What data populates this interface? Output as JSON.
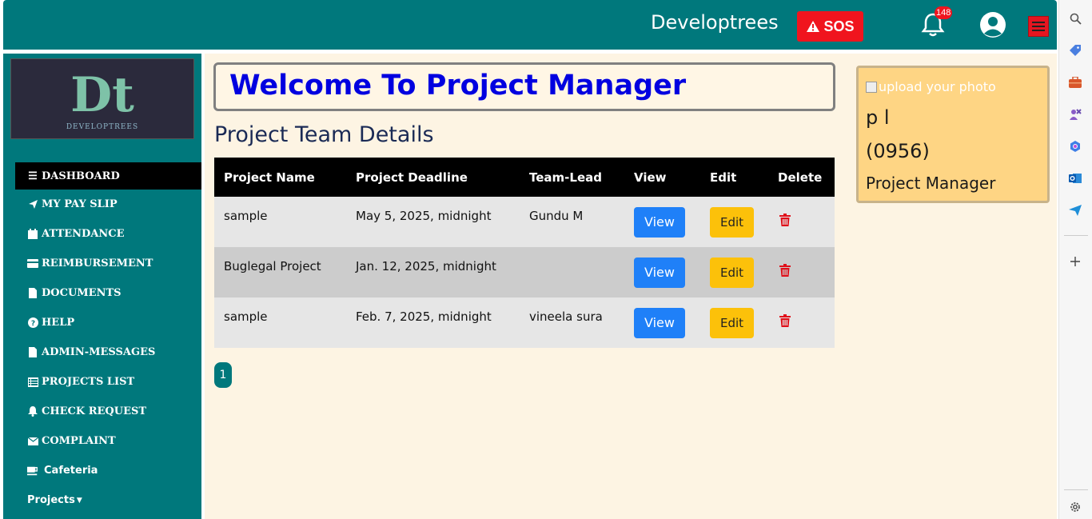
{
  "header": {
    "brand": "Developtrees",
    "sos_label": "SOS",
    "notification_count": "148"
  },
  "sidebar": {
    "logo_letters": "Dt",
    "logo_text": "DEVELOPTREES",
    "items": [
      {
        "label": "DASHBOARD",
        "icon": "bars-icon"
      },
      {
        "label": "MY PAY SLIP",
        "icon": "paper-plane-icon"
      },
      {
        "label": "ATTENDANCE",
        "icon": "calendar-icon"
      },
      {
        "label": "REIMBURSEMENT",
        "icon": "credit-card-icon"
      },
      {
        "label": "DOCUMENTS",
        "icon": "file-icon"
      },
      {
        "label": "HELP",
        "icon": "question-circle-icon"
      },
      {
        "label": "ADMIN-MESSAGES",
        "icon": "file-icon"
      },
      {
        "label": "PROJECTS LIST",
        "icon": "list-icon"
      },
      {
        "label": "CHECK REQUEST",
        "icon": "bell-icon"
      },
      {
        "label": "COMPLAINT",
        "icon": "envelope-icon"
      },
      {
        "label": "Cafeteria",
        "icon": "coffee-icon"
      },
      {
        "label": "Projects",
        "icon": "caret-down-icon"
      }
    ]
  },
  "main": {
    "welcome": "Welcome To Project Manager",
    "section_title": "Project Team Details",
    "table": {
      "headers": [
        "Project Name",
        "Project Deadline",
        "Team-Lead",
        "View",
        "Edit",
        "Delete"
      ],
      "rows": [
        {
          "name": "sample",
          "deadline": "May 5, 2025, midnight",
          "lead": "Gundu M",
          "view": "View",
          "edit": "Edit"
        },
        {
          "name": "Buglegal Project",
          "deadline": "Jan. 12, 2025, midnight",
          "lead": "",
          "view": "View",
          "edit": "Edit"
        },
        {
          "name": "sample",
          "deadline": "Feb. 7, 2025, midnight",
          "lead": "vineela sura",
          "view": "View",
          "edit": "Edit"
        }
      ]
    },
    "pagination": {
      "current": "1"
    }
  },
  "profile": {
    "photo_alt": "upload your photo",
    "name": "p l",
    "employee_id": "(0956)",
    "role": "Project Manager"
  },
  "colors": {
    "teal": "#00787c",
    "sos_red": "#f0141e",
    "view_blue": "#1f80f8",
    "edit_yellow": "#fcc10a",
    "welcome_blue": "#0000e0",
    "profile_bg": "#fed584"
  }
}
